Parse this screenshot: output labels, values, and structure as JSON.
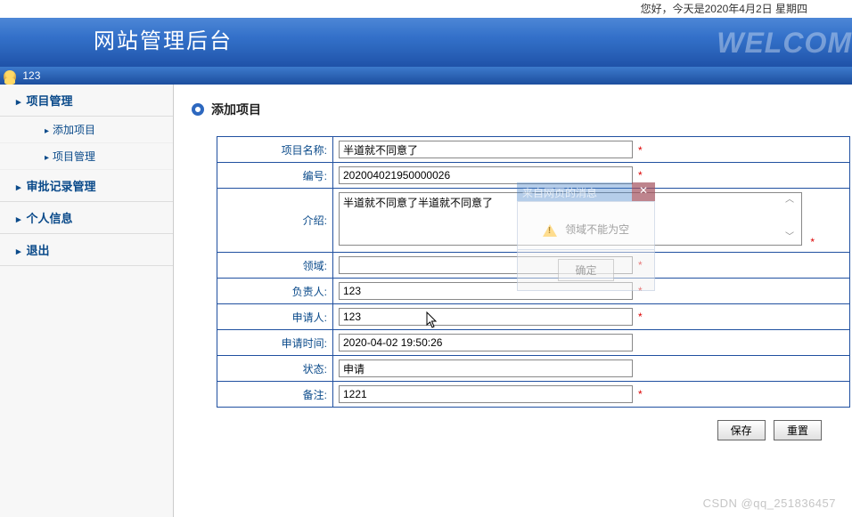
{
  "topbar": {
    "greeting": "您好，今天是2020年4月2日 星期四"
  },
  "header": {
    "title": "网站管理后台",
    "bg_text": "WELCOM"
  },
  "user": {
    "name": "123"
  },
  "sidebar": {
    "items": [
      {
        "label": "项目管理",
        "children": [
          {
            "label": "添加项目"
          },
          {
            "label": "项目管理"
          }
        ]
      },
      {
        "label": "审批记录管理"
      },
      {
        "label": "个人信息"
      },
      {
        "label": "退出"
      }
    ]
  },
  "page": {
    "title": "添加项目"
  },
  "form": {
    "project_name": {
      "label": "项目名称:",
      "value": "半道就不同意了"
    },
    "code": {
      "label": "编号:",
      "value": "202004021950000026"
    },
    "intro": {
      "label": "介绍:",
      "value": "半道就不同意了半道就不同意了"
    },
    "domain": {
      "label": "领域:",
      "value": ""
    },
    "owner": {
      "label": "负责人:",
      "value": "123"
    },
    "applicant": {
      "label": "申请人:",
      "value": "123"
    },
    "apply_time": {
      "label": "申请时间:",
      "value": "2020-04-02 19:50:26"
    },
    "status": {
      "label": "状态:",
      "value": "申请"
    },
    "remark": {
      "label": "备注:",
      "value": "1221"
    }
  },
  "buttons": {
    "save": "保存",
    "reset": "重置"
  },
  "dialog": {
    "title": "来自网页的消息",
    "message": "领域不能为空",
    "ok": "确定"
  },
  "watermark": "CSDN @qq_251836457",
  "req": "*"
}
